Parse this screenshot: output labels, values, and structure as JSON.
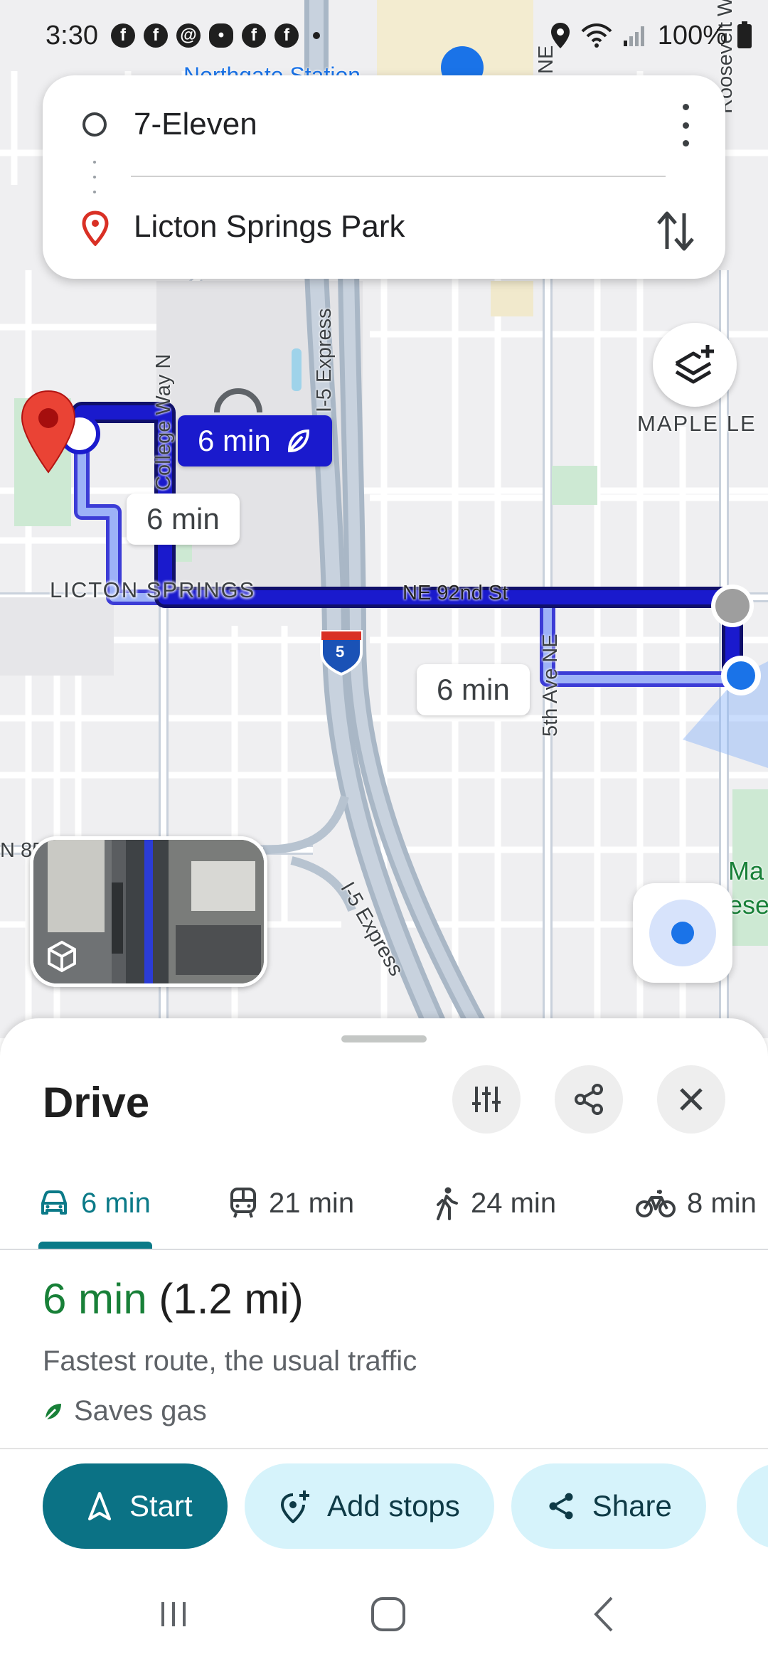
{
  "status_bar": {
    "time": "3:30",
    "battery": "100%",
    "notification_icons": [
      "facebook-icon",
      "facebook-icon",
      "threads-icon",
      "chat-icon",
      "facebook-icon",
      "facebook-icon"
    ]
  },
  "route_search": {
    "origin": "7-Eleven",
    "destination": "Licton Springs Park"
  },
  "map": {
    "labels": {
      "neighborhood": "LICTON SPRINGS",
      "maple_leaf": "MAPLE LE",
      "street_92nd": "NE 92nd St",
      "college_way": "College Way N",
      "i5_express_top": "I-5 Express",
      "i5_express_bottom": "I-5 Express",
      "fifth_ave": "5th Ave NE",
      "northgate": "Northgate Station",
      "n85": "N 85",
      "ne_top": "NE",
      "roosevelt": "Roosevelt W",
      "ma_park": "Ma",
      "ese": "ese",
      "interstate_shield": "5"
    },
    "time_bubbles": {
      "primary": "6 min",
      "alt1": "6 min",
      "alt2": "6 min"
    }
  },
  "sheet": {
    "title": "Drive",
    "modes": [
      {
        "icon": "car-icon",
        "label": "6 min",
        "active": true
      },
      {
        "icon": "transit-icon",
        "label": "21 min",
        "active": false
      },
      {
        "icon": "walk-icon",
        "label": "24 min",
        "active": false
      },
      {
        "icon": "bike-icon",
        "label": "8 min",
        "active": false
      }
    ],
    "summary": {
      "eta": "6 min",
      "distance": "(1.2 mi)",
      "description": "Fastest route, the usual traffic",
      "gas": "Saves gas"
    },
    "actions": {
      "start": "Start",
      "add_stops": "Add stops",
      "share": "Share"
    }
  },
  "colors": {
    "route": "#1a1acd",
    "alt_route": "#8aa4f5",
    "accent": "#0b7285",
    "eta_green": "#188038",
    "destination_pin": "#ea4335"
  }
}
